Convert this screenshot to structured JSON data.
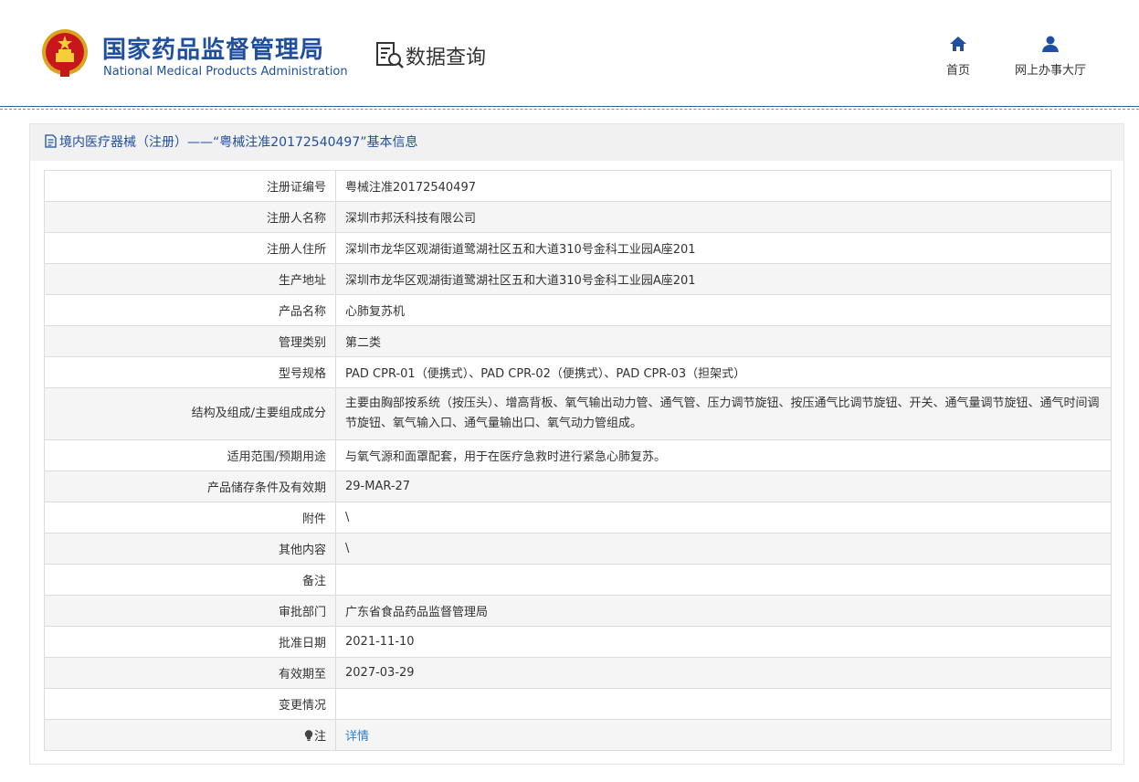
{
  "header": {
    "brand_cn": "国家药品监督管理局",
    "brand_en": "National Medical Products Administration",
    "section": "数据查询",
    "nav": [
      {
        "label": "首页",
        "icon": "home-icon"
      },
      {
        "label": "网上办事大厅",
        "icon": "user-icon"
      }
    ],
    "colors": {
      "brand": "#1f4fa0",
      "link": "#2a7fd4",
      "row_alt": "#f5f5f5"
    }
  },
  "panel": {
    "title": "境内医疗器械（注册）——“粤械注准20172540497”基本信息",
    "rows": [
      {
        "key": "注册证编号",
        "value": "粤械注准20172540497"
      },
      {
        "key": "注册人名称",
        "value": "深圳市邦沃科技有限公司"
      },
      {
        "key": "注册人住所",
        "value": "深圳市龙华区观湖街道鹭湖社区五和大道310号金科工业园A座201"
      },
      {
        "key": "生产地址",
        "value": "深圳市龙华区观湖街道鹭湖社区五和大道310号金科工业园A座201"
      },
      {
        "key": "产品名称",
        "value": "心肺复苏机"
      },
      {
        "key": "管理类别",
        "value": "第二类"
      },
      {
        "key": "型号规格",
        "value": "PAD CPR-01（便携式）、PAD CPR-02（便携式）、PAD CPR-03（担架式）"
      },
      {
        "key": "结构及组成/主要组成成分",
        "value": "主要由胸部按系统（按压头）、增高背板、氧气输出动力管、通气管、压力调节旋钮、按压通气比调节旋钮、开关、通气量调节旋钮、通气时间调节旋钮、氧气输入口、通气量输出口、氧气动力管组成。"
      },
      {
        "key": "适用范围/预期用途",
        "value": "与氧气源和面罩配套，用于在医疗急救时进行紧急心肺复苏。"
      },
      {
        "key": "产品储存条件及有效期",
        "value": "29-MAR-27"
      },
      {
        "key": "附件",
        "value": "\\"
      },
      {
        "key": "其他内容",
        "value": "\\"
      },
      {
        "key": "备注",
        "value": ""
      },
      {
        "key": "审批部门",
        "value": "广东省食品药品监督管理局"
      },
      {
        "key": "批准日期",
        "value": "2021-11-10"
      },
      {
        "key": "有效期至",
        "value": "2027-03-29"
      },
      {
        "key": "变更情况",
        "value": ""
      }
    ],
    "note_row": {
      "key": "注",
      "value": "详情",
      "icon": "lightbulb-icon"
    }
  }
}
